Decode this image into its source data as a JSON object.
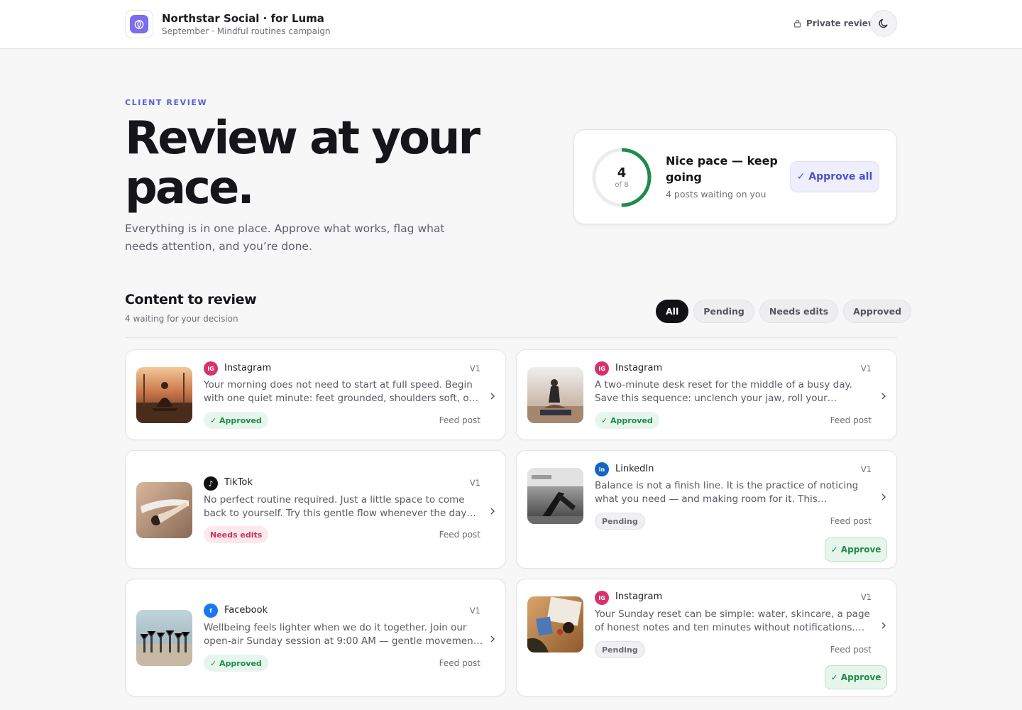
{
  "header": {
    "brand_title": "Northstar Social · for Luma",
    "brand_subtitle": "September · Mindful routines campaign",
    "private_label": "Private review",
    "icons": {
      "brand": "leaf-icon",
      "private": "lock-icon",
      "theme": "moon-icon"
    }
  },
  "hero": {
    "eyebrow": "CLIENT REVIEW",
    "title": "Review at your pace.",
    "description": "Everything is in one place. Approve what works, flag what needs attention, and you’re done."
  },
  "progress": {
    "reviewed": "4",
    "total_label": "of 8",
    "completion_fraction": 0.5,
    "title": "Nice pace — keep going",
    "subtitle": "4 posts waiting on you",
    "approve_all_label": "✓ Approve all",
    "accent_color": "#1f8a4c"
  },
  "content": {
    "title": "Content to review",
    "subtitle": "4 waiting for your decision",
    "filters": [
      {
        "label": "All",
        "active": true
      },
      {
        "label": "Pending",
        "active": false
      },
      {
        "label": "Needs edits",
        "active": false
      },
      {
        "label": "Approved",
        "active": false
      }
    ]
  },
  "posts": [
    {
      "platform": "Instagram",
      "platform_code": "IG",
      "platform_color": "#d6336c",
      "version": "V1",
      "caption": "Your morning does not need to start at full speed. Begin with one quiet minute: feet grounded, shoulders soft, one slow breath in and out.",
      "status": "✓ Approved",
      "status_type": "approved",
      "format": "Feed post",
      "thumbnail": "sunrise-meditation-photo"
    },
    {
      "platform": "Instagram",
      "platform_code": "IG",
      "platform_color": "#d6336c",
      "version": "V1",
      "caption": "A two-minute desk reset for the middle of a busy day. Save this sequence: unclench your jaw, roll your shoulders back, and breathe.",
      "status": "✓ Approved",
      "status_type": "approved",
      "format": "Feed post",
      "thumbnail": "seated-yoga-photo"
    },
    {
      "platform": "TikTok",
      "platform_code": "♪",
      "platform_color": "#111111",
      "version": "V1",
      "caption": "No perfect routine required. Just a little space to come back to yourself. Try this gentle flow whenever the day feels too loud.",
      "status": "Needs edits",
      "status_type": "needs",
      "format": "Feed post",
      "thumbnail": "stretch-pose-photo"
    },
    {
      "platform": "LinkedIn",
      "platform_code": "in",
      "platform_color": "#1565c0",
      "version": "V1",
      "caption": "Balance is not a finish line. It is the practice of noticing what you need — and making room for it. This September, our team is exploring.",
      "status": "Pending",
      "status_type": "pending",
      "format": "Feed post",
      "thumbnail": "mono-yoga-photo",
      "approve_label": "✓ Approve"
    },
    {
      "platform": "Facebook",
      "platform_code": "f",
      "platform_color": "#1877f2",
      "version": "V1",
      "caption": "Wellbeing feels lighter when we do it together. Join our open-air Sunday session at 9:00 AM — gentle movement, sea air and good company.",
      "status": "✓ Approved",
      "status_type": "approved",
      "format": "Feed post",
      "thumbnail": "beach-group-photo"
    },
    {
      "platform": "Instagram",
      "platform_code": "IG",
      "platform_color": "#d6336c",
      "version": "V1",
      "caption": "Your Sunday reset can be simple: water, skincare, a page of honest notes and ten minutes without notifications. What is yours?",
      "status": "Pending",
      "status_type": "pending",
      "format": "Feed post",
      "thumbnail": "flatlay-journal-photo",
      "approve_label": "✓ Approve"
    }
  ]
}
